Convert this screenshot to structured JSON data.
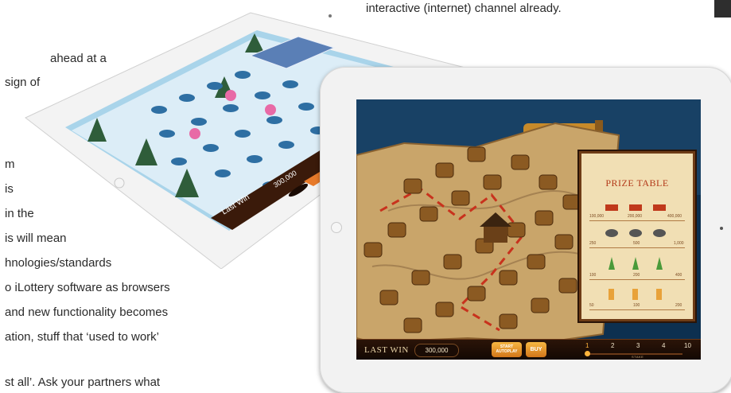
{
  "page": {
    "text_lines": [
      "interactive (internet) channel already.",
      "ahead at a",
      "sign of",
      "m",
      "is",
      "in  the",
      "is  will  mean",
      "hnologies/standards",
      "o  iLottery software as browsers",
      "and new functionality becomes",
      "ation, stuff that ‘used to work’",
      "st all’. Ask your partners what"
    ]
  },
  "back_tablet": {
    "game_bar": {
      "last_win_label": "Last Win",
      "last_win_value": "300,000"
    }
  },
  "front_tablet": {
    "game_bar": {
      "last_win_label": "LAST WIN",
      "last_win_value": "300,000",
      "autoplay_line1": "START",
      "autoplay_line2": "AUTOPLAY",
      "buy_label": "BUY",
      "stake_values": [
        "1",
        "2",
        "3",
        "4",
        "10"
      ],
      "stake_label": "STAKE"
    },
    "prize_table": {
      "title": "PRIZE TABLE",
      "rows": [
        {
          "icon": "ship-icon",
          "values": [
            "100,000",
            "200,000",
            "400,000"
          ]
        },
        {
          "icon": "turtle-icon",
          "values": [
            "250",
            "500",
            "1,000"
          ]
        },
        {
          "icon": "parrot-icon",
          "values": [
            "100",
            "200",
            "400"
          ]
        },
        {
          "icon": "bottle-icon",
          "values": [
            "50",
            "100",
            "200"
          ]
        }
      ]
    }
  },
  "colors": {
    "bar_bg": "#1c0d05",
    "button_orange": "#f6a32f",
    "prize_title_red": "#b33a1a",
    "map_parchment": "#c9a56a"
  }
}
